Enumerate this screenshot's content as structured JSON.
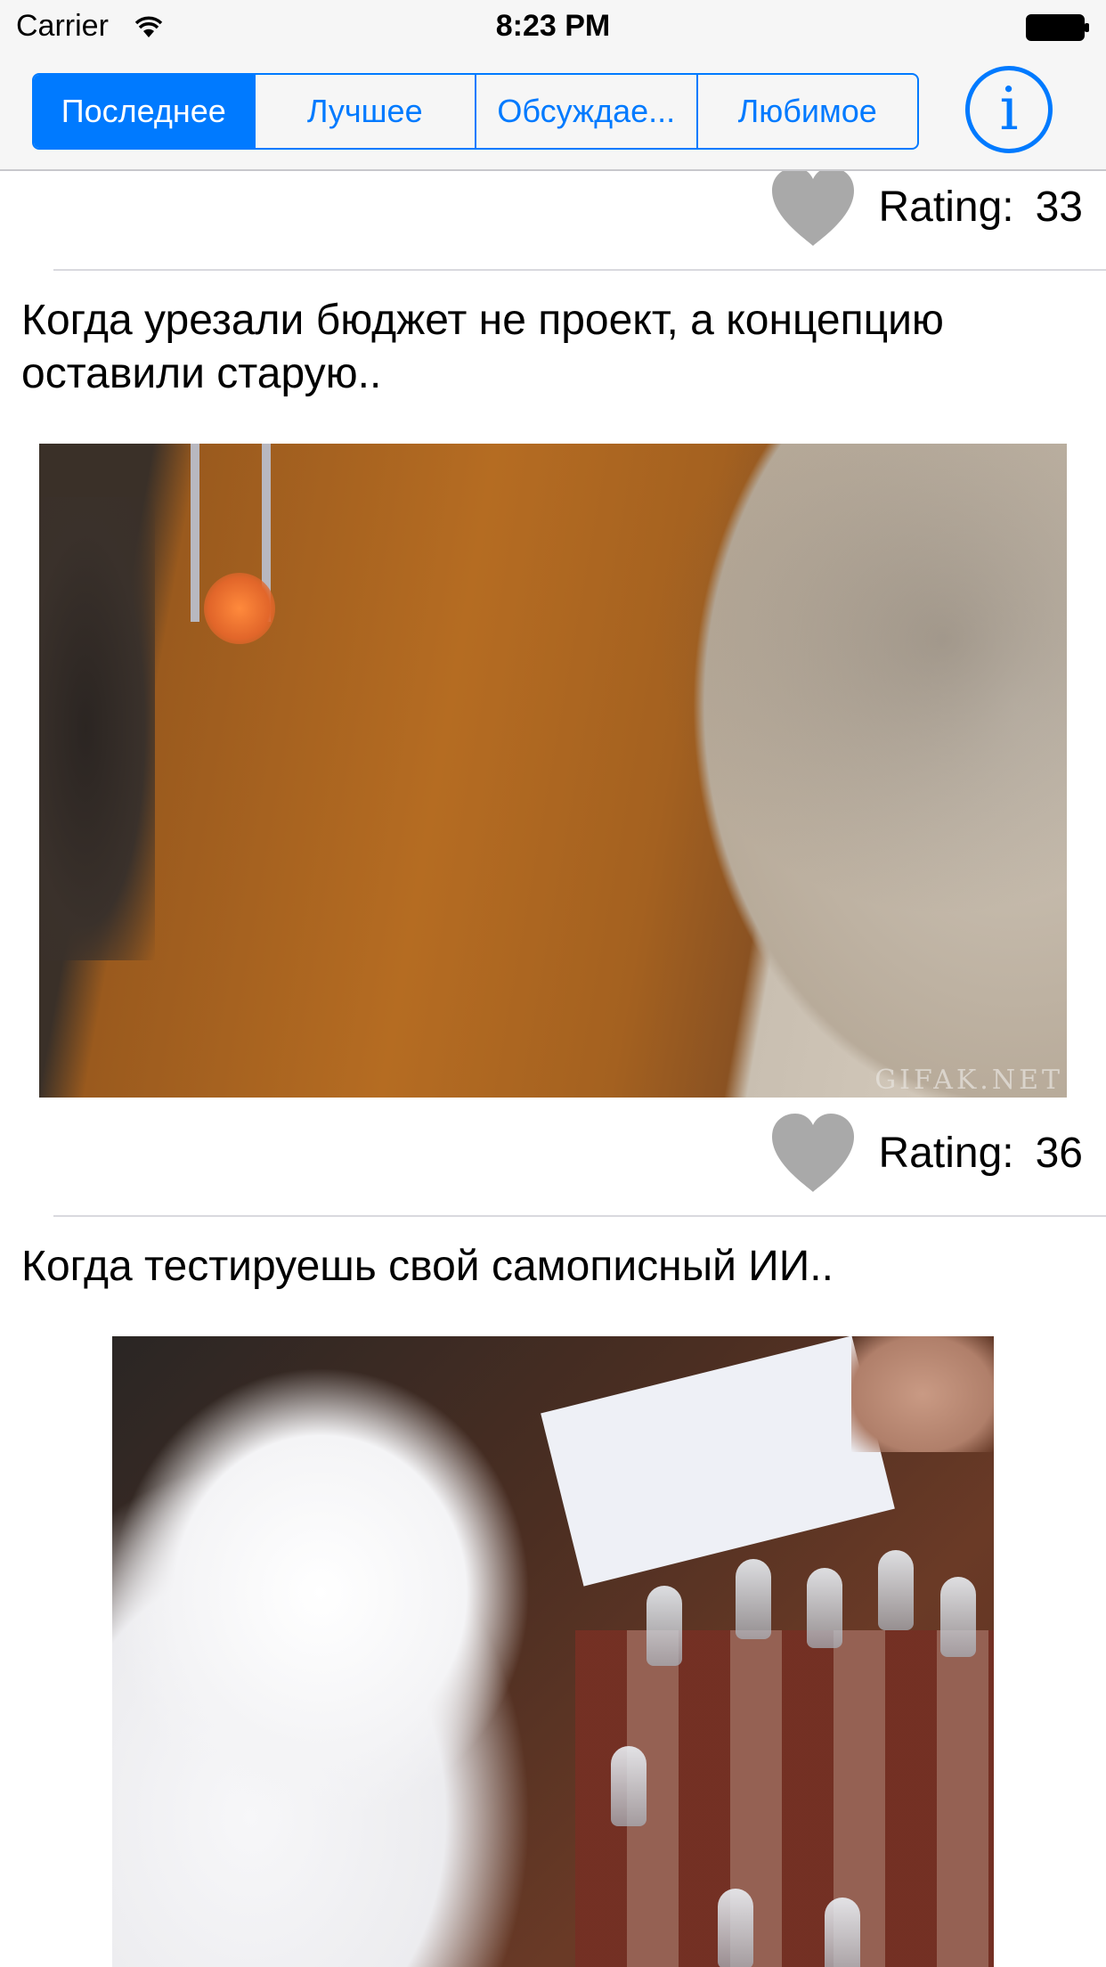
{
  "status_bar": {
    "carrier": "Carrier",
    "time": "8:23 PM"
  },
  "segmented_control": {
    "selected_index": 0,
    "segments": [
      "Последнее",
      "Лучшее",
      "Обсуждае...",
      "Любимое"
    ]
  },
  "info_button": {
    "glyph": "i"
  },
  "colors": {
    "accent": "#007aff",
    "heart": "#a9a9a9",
    "separator": "#d9d9de"
  },
  "feed": {
    "rating_label": "Rating:",
    "top_rating": {
      "value": "33"
    },
    "posts": [
      {
        "title": "Когда урезали бюджет не проект, а концепцию оставили старую..",
        "image_watermark": "GIFAK.NET",
        "rating": "36"
      },
      {
        "title": "Когда тестируешь свой самописный ИИ.."
      }
    ]
  }
}
